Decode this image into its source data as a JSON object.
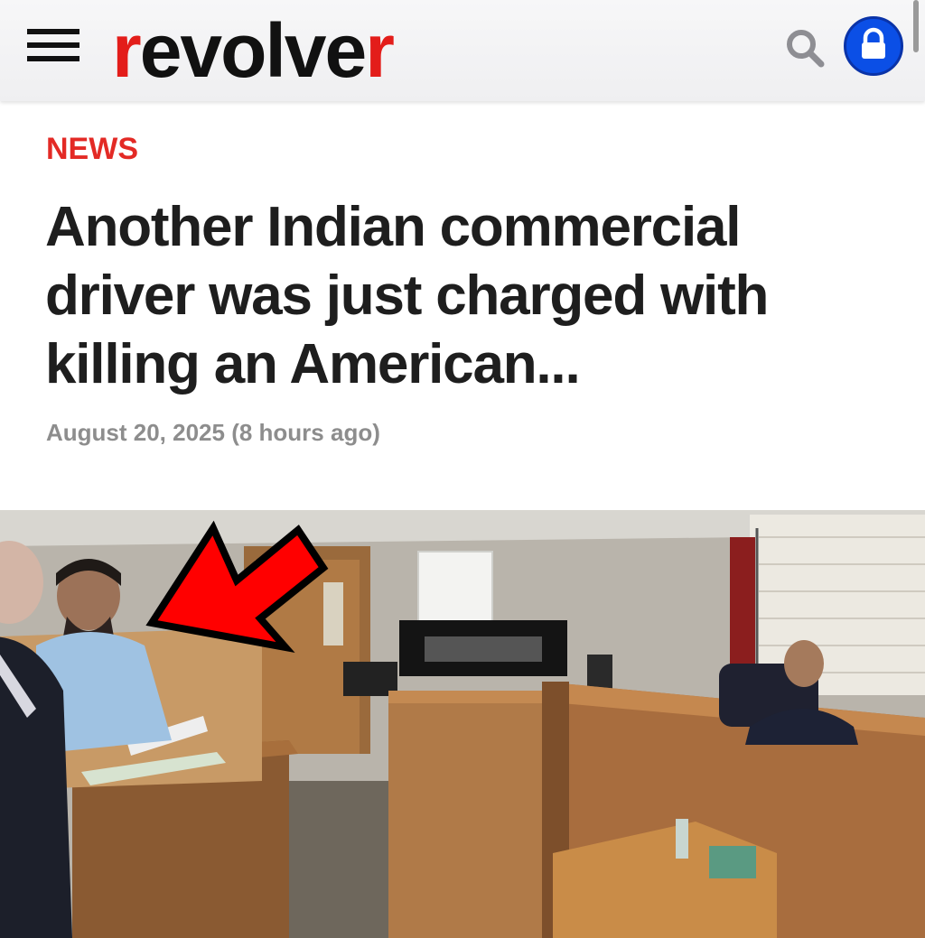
{
  "header": {
    "logo_part1": "r",
    "logo_part2": "evolve",
    "logo_part3": "r",
    "menu_icon": "hamburger-menu-icon",
    "search_icon": "search-icon",
    "lock_icon": "lock-icon"
  },
  "article": {
    "category": "NEWS",
    "headline": "Another Indian commercial driver was just charged with killing an American...",
    "date": "August 20, 2025 (8 hours ago)"
  },
  "colors": {
    "brand_red": "#e31d1a",
    "category_red": "#e32a25",
    "lock_blue": "#0b4fe6",
    "arrow_red": "#ff0000"
  }
}
